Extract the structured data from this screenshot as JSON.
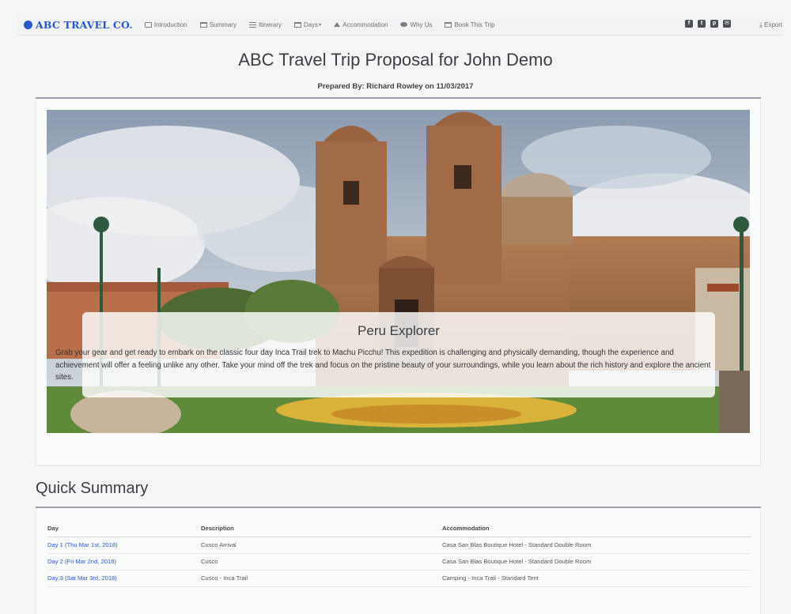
{
  "brand": "ABC TRAVEL CO.",
  "nav": [
    {
      "label": "Introduction",
      "icon": "box"
    },
    {
      "label": "Summary",
      "icon": "card"
    },
    {
      "label": "Itinerary",
      "icon": "list"
    },
    {
      "label": "Days",
      "icon": "calendar"
    },
    {
      "label": "Accommodation",
      "icon": "home"
    },
    {
      "label": "Why Us",
      "icon": "chat"
    },
    {
      "label": "Book This Trip",
      "icon": "card"
    }
  ],
  "social": [
    "facebook-icon",
    "twitter-icon",
    "pinterest-icon",
    "email-icon"
  ],
  "export_label": "Export",
  "title": "ABC Travel Trip Proposal for John Demo",
  "prepared_by": "Prepared By: Richard Rowley on 11/03/2017",
  "hero": {
    "caption_title": "Peru Explorer",
    "caption_text": "Grab your gear and get ready to embark on the classic four day Inca Trail trek to Machu Picchu! This expedition is challenging and physically demanding, though the experience and achievement will offer a feeling unlike any other. Take your mind off the trek and focus on the pristine beauty of your surroundings, while you learn about the rich history and explore the ancient sites."
  },
  "summary": {
    "title": "Quick Summary",
    "headers": [
      "Day",
      "Description",
      "Accommodation"
    ],
    "rows": [
      [
        "Day 1 (Thu Mar 1st, 2018)",
        "Cusco Arrival",
        "Casa San Blas Boutique Hotel - Standard Double Room"
      ],
      [
        "Day 2 (Fri Mar 2nd, 2018)",
        "Cusco",
        "Casa San Blas Boutique Hotel - Standard Double Room"
      ],
      [
        "Day 3 (Sat Mar 3rd, 2018)",
        "Cusco - Inca Trail",
        "Camping - Inca Trail - Standard Tent"
      ]
    ]
  },
  "colors": {
    "brand": "#2a58c9",
    "link": "#2a58c9",
    "rule": "#9aa0a6"
  }
}
